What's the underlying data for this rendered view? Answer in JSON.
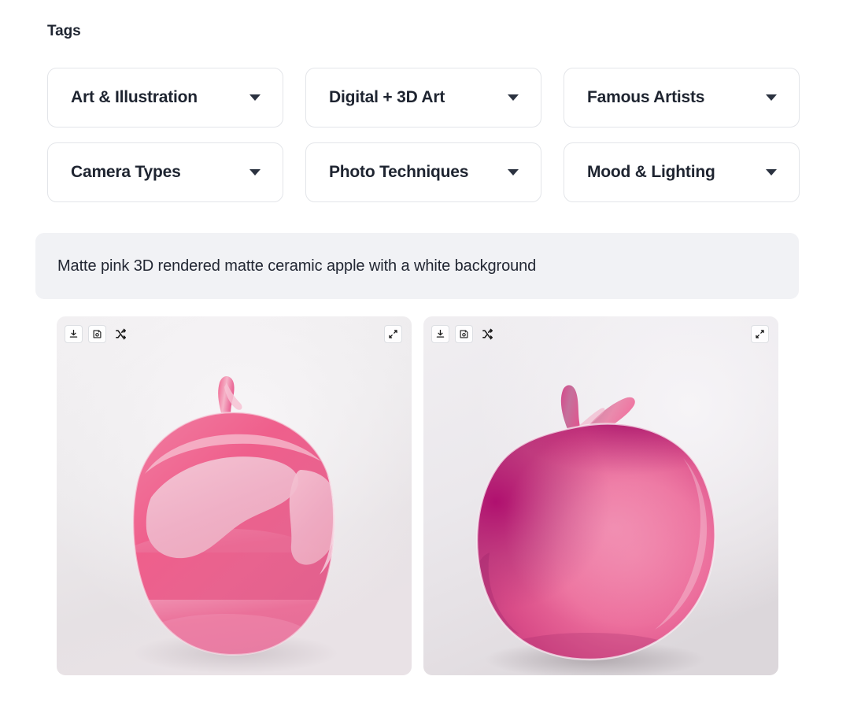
{
  "section": {
    "heading": "Tags"
  },
  "tags": [
    {
      "label": "Art & Illustration",
      "icon": "chevron-down-icon"
    },
    {
      "label": "Digital + 3D Art",
      "icon": "chevron-down-icon"
    },
    {
      "label": "Famous Artists",
      "icon": "chevron-down-icon"
    },
    {
      "label": "Camera Types",
      "icon": "chevron-down-icon"
    },
    {
      "label": "Photo Techniques",
      "icon": "chevron-down-icon"
    },
    {
      "label": "Mood & Lighting",
      "icon": "chevron-down-icon"
    }
  ],
  "prompt": {
    "text": "Matte pink 3D rendered matte ceramic apple with a white background"
  },
  "results": {
    "cards": [
      {
        "alt": "Matte pink ceramic apple, glossy two-tone pink, front view",
        "toolbar": [
          {
            "icon": "download-icon",
            "label": "Download"
          },
          {
            "icon": "save-icon",
            "label": "Save"
          },
          {
            "icon": "shuffle-icon",
            "label": "Variations"
          }
        ],
        "expand": {
          "icon": "expand-icon",
          "label": "Expand"
        }
      },
      {
        "alt": "Magenta pink ceramic apple, soft gradient, three-quarter view",
        "toolbar": [
          {
            "icon": "download-icon",
            "label": "Download"
          },
          {
            "icon": "save-icon",
            "label": "Save"
          },
          {
            "icon": "shuffle-icon",
            "label": "Variations"
          }
        ],
        "expand": {
          "icon": "expand-icon",
          "label": "Expand"
        }
      }
    ]
  },
  "colors": {
    "page_background": "#ffffff",
    "text_primary": "#1e2430",
    "select_border": "#e3e5e9",
    "prompt_background": "#f1f2f5",
    "apple_light_pink": "#eda8bd",
    "apple_mid_pink": "#e8638f",
    "apple_hot_pink": "#ef4d7d",
    "apple_magenta": "#b5337a",
    "card_background": "#eceaec"
  }
}
